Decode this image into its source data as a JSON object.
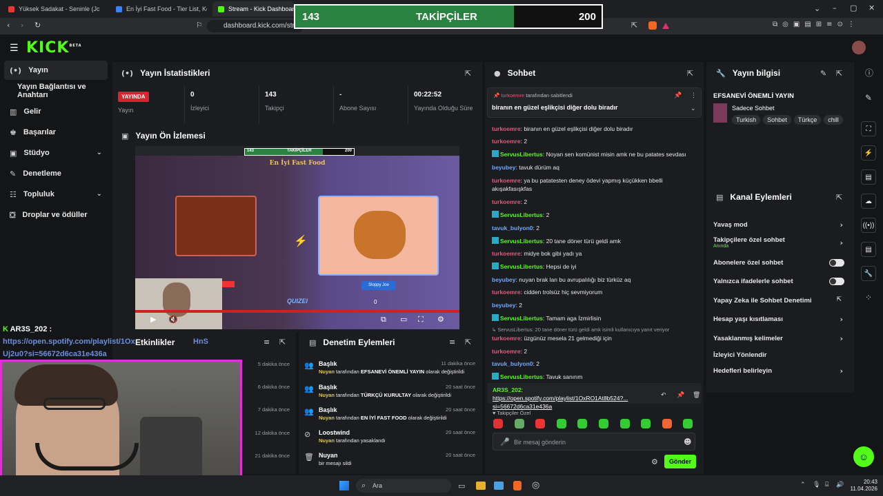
{
  "browser": {
    "tabs": [
      {
        "label": "Yüksek Sadakat - Seninle (JoyTurk",
        "color": "#e53935"
      },
      {
        "label": "En İyi Fast Food - Tier List, Kör Sıralama",
        "color": "#3b82f6"
      },
      {
        "label": "Stream - Kick Dashboard",
        "color": "#53fc18"
      }
    ],
    "url": "dashboard.kick.com/stream"
  },
  "overlay": {
    "current": "143",
    "label": "TAKİPÇİLER",
    "target": "200",
    "progress": 0.715
  },
  "kick": {
    "logo": "KICK",
    "beta": "BETA"
  },
  "sidebar": {
    "items": [
      {
        "icon": "(•)",
        "label": "Yayın",
        "selected": true
      },
      {
        "icon": "",
        "label": "Yayın Bağlantısı ve Anahtarı"
      },
      {
        "icon": "▥",
        "label": "Gelir"
      },
      {
        "icon": "♚",
        "label": "Başarılar"
      },
      {
        "icon": "▣",
        "label": "Stüdyo",
        "chevron": "⌄"
      },
      {
        "icon": "✎",
        "label": "Denetleme"
      },
      {
        "icon": "☷",
        "label": "Topluluk",
        "chevron": "⌄"
      },
      {
        "icon": "⛋",
        "label": "Droplar ve ödüller"
      }
    ]
  },
  "stats": {
    "title": "Yayın İstatistikleri",
    "live_badge": "YAYINDA",
    "live_label": "Yayın",
    "cells": [
      {
        "value": "0",
        "label": "İzleyici"
      },
      {
        "value": "143",
        "label": "Takipçi"
      },
      {
        "value": "-",
        "label": "Abone Sayısı"
      },
      {
        "value": "00:22:52",
        "label": "Yayında Olduğu Süre"
      }
    ]
  },
  "preview": {
    "title": "Yayın Ön İzlemesi",
    "inner_overlay": {
      "current": "143",
      "label": "TAKİPÇİLER",
      "target": "200"
    },
    "inner_title": "En İyi Fast Food",
    "button_label": "Sloppy Joe",
    "score": "0",
    "brand": "QUIZEI"
  },
  "events": {
    "title": "Etkinlikler",
    "times": [
      "5 dakika önce",
      "6 dakika önce",
      "7 dakika önce",
      "12 dakika önce",
      "21 dakika önce"
    ]
  },
  "spotify_overlay": {
    "user": "AR3S_202 :",
    "text": "https://open.spotify.com/playlist/1Ox...Uj2u0?si=56672d6ca31e436a",
    "line1": "https://open.spotify.com/playlist/1Ox",
    "line2": "HnS",
    "line3": "Uj2u0?si=56672d6ca31e436a"
  },
  "mod_actions": {
    "title": "Denetim Eylemleri",
    "items": [
      {
        "icon": "👥",
        "title": "Başlık",
        "user": "Nuyan",
        "mid": " tarafından ",
        "value": "EFSANEVİ ÖNEMLİ YAYIN",
        "suffix": " olarak değiştirildi",
        "time": "11 dakika önce"
      },
      {
        "icon": "👥",
        "title": "Başlık",
        "user": "Nuyan",
        "mid": " tarafından ",
        "value": "TÜRKÇÜ KURULTAY",
        "suffix": " olarak değiştirildi",
        "time": "20 saat önce"
      },
      {
        "icon": "👥",
        "title": "Başlık",
        "user": "Nuyan",
        "mid": " tarafından ",
        "value": "EN İYİ FAST FOOD",
        "suffix": " olarak değiştirildi",
        "time": "20 saat önce"
      },
      {
        "icon": "⊘",
        "title": "Loostwind",
        "user": "Nuyan",
        "mid": " tarafından yasaklandı",
        "value": "",
        "suffix": "",
        "time": "20 saat önce"
      },
      {
        "icon": "🗑",
        "title": "Nuyan",
        "user": "",
        "mid": "bir mesajı sildi",
        "value": "",
        "suffix": "",
        "time": "20 saat önce"
      }
    ]
  },
  "chat": {
    "title": "Sohbet",
    "pinned_by": "turkoemre",
    "pinned_suffix": " tarafından sabitlendi",
    "pinned_text": "biranın en güzel eşlikçisi diğer dolu biradır",
    "messages": [
      {
        "user": "turkoemre",
        "color": "#e8567a",
        "text": "biranın en güzel eşlikçisi diğer dolu biradır"
      },
      {
        "user": "turkoemre",
        "color": "#e8567a",
        "text": "2"
      },
      {
        "user": "ServusLibertus",
        "color": "#53fc18",
        "badge": true,
        "text": "Noyan sen komünist misin amk ne bu patates sevdası"
      },
      {
        "user": "beyubey",
        "color": "#6fa8ff",
        "text": "tavuk dürüm aq"
      },
      {
        "user": "turkoemre",
        "color": "#e8567a",
        "text": "ya bu patatesten deney ödevi yapmış küçükken bbelli akışakfasışkfas"
      },
      {
        "user": "turkoemre",
        "color": "#e8567a",
        "text": "2"
      },
      {
        "user": "ServusLibertus",
        "color": "#53fc18",
        "badge": true,
        "text": "2"
      },
      {
        "user": "tavuk_bulyon0",
        "color": "#6fa8ff",
        "text": "2"
      },
      {
        "user": "ServusLibertus",
        "color": "#53fc18",
        "badge": true,
        "text": "20 tane döner türü geldi amk"
      },
      {
        "user": "turkoemre",
        "color": "#e8567a",
        "text": "midye bok gibi yadı ya"
      },
      {
        "user": "ServusLibertus",
        "color": "#53fc18",
        "badge": true,
        "text": "Hepsi de iyi"
      },
      {
        "user": "beyubey",
        "color": "#6fa8ff",
        "text": "nuyan brak lan bu avrupalılığı biz türküz aq"
      },
      {
        "user": "turkoemre",
        "color": "#e8567a",
        "text": "cidden trolsüz hiç sevmiyorum"
      },
      {
        "user": "beyubey",
        "color": "#6fa8ff",
        "text": "2"
      },
      {
        "user": "ServusLibertus",
        "color": "#53fc18",
        "badge": true,
        "text": "Tamam aga İzmirlisin"
      }
    ],
    "reply_note": "↳ ServusLibertus: 20 tane döner türü geldi amk isimli kullanıcıya yanıt veriyor",
    "messages2": [
      {
        "user": "turkoemre",
        "color": "#e8567a",
        "text": "üzgünüz mesela 21 gelmediği için"
      },
      {
        "user": "turkoemre",
        "color": "#e8567a",
        "text": "2"
      },
      {
        "user": "tavuk_bulyon0",
        "color": "#6fa8ff",
        "text": "2"
      },
      {
        "user": "ServusLibertus",
        "color": "#53fc18",
        "badge": true,
        "text": "Tavuk sanırım"
      }
    ],
    "highlight_user": "AR3S_202",
    "highlight_link": "https://open.spotify.com/playlist/1OxRO1At8b524?...",
    "highlight_link2": "si=56672d6ca31e436a",
    "emote_label": "♥ Takipçiler Özel",
    "input_placeholder": "Bir mesaj gönderin",
    "send_label": "Gönder"
  },
  "stream_info": {
    "title": "Yayın bilgisi",
    "stream_title": "EFSANEVİ ÖNEMLİ YAYIN",
    "category": "Sadece Sohbet",
    "tags": [
      "Turkish",
      "Sohbet",
      "Türkçe",
      "chill"
    ]
  },
  "channel_actions": {
    "title": "Kanal Eylemleri",
    "items": [
      {
        "label": "Yavaş mod",
        "kind": "chevron"
      },
      {
        "label": "Takipçilere özel sohbet",
        "sub": "Anında",
        "kind": "chevron"
      },
      {
        "label": "Abonelere özel sohbet",
        "kind": "toggle"
      },
      {
        "label": "Yalnızca ifadelerle sohbet",
        "kind": "toggle"
      },
      {
        "label": "Yapay Zeka ile Sohbet Denetimi",
        "kind": "external"
      },
      {
        "label": "Hesap yaşı kısıtlaması",
        "kind": "chevron"
      },
      {
        "label": "Yasaklanmış kelimeler",
        "kind": "chevron"
      },
      {
        "label": "İzleyici Yönlendir",
        "kind": "none"
      },
      {
        "label": "Hedefleri belirleyin",
        "kind": "chevron"
      }
    ]
  },
  "taskbar": {
    "search_placeholder": "Ara",
    "time": "20:43",
    "date": "11.04.2026"
  }
}
